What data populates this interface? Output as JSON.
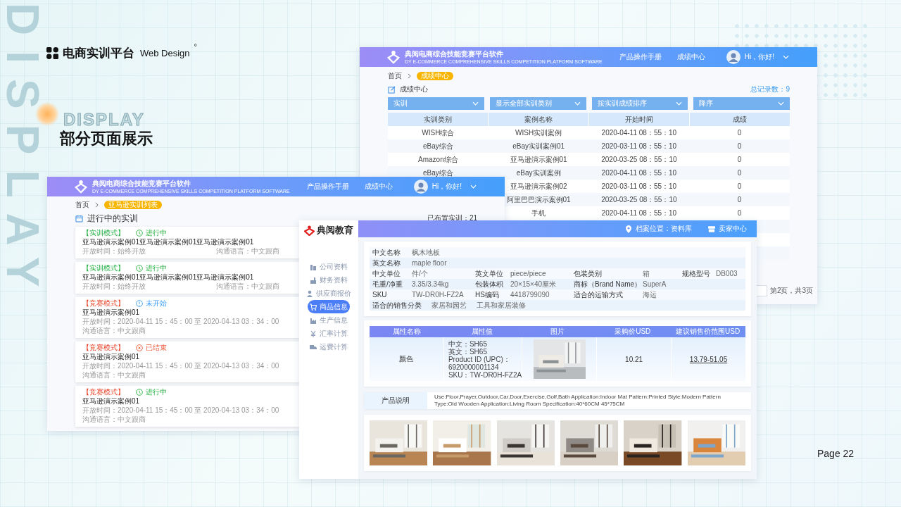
{
  "slide": {
    "watermark_vertical": "DISPLAY",
    "brand": "电商实训平台",
    "brand_sub": "Web Design",
    "brand_mark": "°",
    "watermark": "DISPLAY",
    "heading": "部分页面展示",
    "page": "Page 22"
  },
  "grades_window": {
    "title": "典阅电商综合技能竞赛平台软件",
    "subtitle": "DY E-COMMERCE COMPREHENSIVE SKILLS COMPETITION PLATFORM SOFTWARE",
    "nav": [
      "产品操作手册",
      "成绩中心"
    ],
    "greeting": "Hi，你好!",
    "breadcrumb": [
      "首页",
      "成绩中心"
    ],
    "heading": "成绩中心",
    "total": "总记录数：9",
    "filters": [
      "实训",
      "显示全部实训类别",
      "按实训成绩排序",
      "降序"
    ],
    "columns": [
      "实训类别",
      "案例名称",
      "开始时间",
      "成绩"
    ],
    "rows": [
      [
        "WISH综合",
        "WISH实训案例",
        "2020-04-11 08：55：10",
        "0"
      ],
      [
        "eBay综合",
        "eBay实训案例01",
        "2020-03-11 08：55：10",
        "0"
      ],
      [
        "Amazon综合",
        "亚马逊演示案例01",
        "2020-03-25 08：55：10",
        "0"
      ],
      [
        "eBay综合",
        "eBay实训案例",
        "2020-04-11 08：55：10",
        "0"
      ],
      [
        null,
        "亚马逊演示案例02",
        "2020-03-11 08：55：10",
        "0"
      ],
      [
        null,
        "阿里巴巴演示案例01",
        "2020-03-25 08：55：10",
        "0"
      ],
      [
        null,
        "手机",
        "2020-04-11 08：55：10",
        "0"
      ]
    ],
    "pagination": "第2页，共3页"
  },
  "training_window": {
    "title": "典阅电商综合技能竞赛平台软件",
    "subtitle": "DY E-COMMERCE COMPREHENSIVE SKILLS COMPETITION PLATFORM SOFTWARE",
    "nav": [
      "产品操作手册",
      "成绩中心"
    ],
    "greeting": "Hi，你好!",
    "breadcrumb": [
      "首页",
      "亚马逊实训列表"
    ],
    "heading": "进行中的实训",
    "count": "已布置实训：21",
    "cards": [
      {
        "kind": "training",
        "mode": "【实训模式】",
        "status": {
          "kind": "ongoing",
          "label": "进行中"
        },
        "title": "亚马逊演示案例01亚马逊演示案例01亚马逊演示案例01",
        "open_time": "开放时间：始终开放",
        "language": "沟通语言：中文跟商"
      },
      {
        "kind": "training",
        "mode": "【实训模式】",
        "status": {
          "kind": "ongoing",
          "label": "进行中"
        },
        "title": "亚马逊演示案例01亚马逊演示案例01亚马逊演示案例01",
        "open_time": "开放时间：始终开放",
        "language": "沟通语言：中文跟商"
      },
      {
        "kind": "contest",
        "mode": "【竞赛模式】",
        "status": {
          "kind": "pending",
          "label": "未开始"
        },
        "title": "亚马逊演示案例01",
        "open_time": "开放时间：2020-04-11 15：45：00 至 2020-04-13 03：34：00",
        "language": "沟通语言：中文跟商"
      },
      {
        "kind": "contest",
        "mode": "【竞赛模式】",
        "status": {
          "kind": "ended",
          "label": "已结束"
        },
        "title": "亚马逊演示案例01",
        "open_time": "开放时间：2020-04-11 15：45：00 至 2020-04-13 03：34：00",
        "language": "沟通语言：中文跟商"
      },
      {
        "kind": "contest",
        "mode": "【竞赛模式】",
        "status": {
          "kind": "ongoing",
          "label": "进行中"
        },
        "title": "亚马逊演示案例01",
        "open_time": "开放时间：2020-04-11 15：45：00 至 2020-04-13 03：34：00",
        "language": "沟通语言：中文跟商"
      }
    ]
  },
  "product_window": {
    "brand": "典阅教育",
    "menu": [
      {
        "label": "公司资料",
        "selected": false
      },
      {
        "label": "财务资料",
        "selected": false
      },
      {
        "label": "供应商报价",
        "selected": false
      },
      {
        "label": "商品信息",
        "selected": true
      },
      {
        "label": "生产信息",
        "selected": false
      },
      {
        "label": "汇率计算",
        "selected": false
      },
      {
        "label": "运费计算",
        "selected": false
      }
    ],
    "location": "档案位置：资料库",
    "seller": "卖家中心",
    "info_rows": [
      {
        "kind": "pairs",
        "cells": [
          {
            "label": "中文名称",
            "value": "枫木地板"
          }
        ]
      },
      {
        "kind": "pairs",
        "cells": [
          {
            "label": "英文名称",
            "value": "maple floor"
          }
        ]
      },
      {
        "kind": "pairs",
        "cells": [
          {
            "label": "中文单位",
            "value": "件/个"
          },
          {
            "label": "英文单位",
            "value": "piece/piece"
          },
          {
            "label": "包装类别",
            "value": "箱"
          },
          {
            "label": "规格型号",
            "value": "DB003"
          }
        ]
      },
      {
        "kind": "pairs",
        "cells": [
          {
            "label": "毛重/净重",
            "value": "3.35/3.34kg"
          },
          {
            "label": "包装体积",
            "value": "20×15×40厘米"
          },
          {
            "label": "商标（Brand Name）",
            "value": "SuperA"
          }
        ]
      },
      {
        "kind": "pairs",
        "cells": [
          {
            "label": "SKU",
            "value": "TW-DR0H-FZ2A"
          },
          {
            "label": "HS编码",
            "value": "4418799090"
          },
          {
            "label": "适合的运输方式",
            "value": "海运"
          }
        ]
      },
      {
        "kind": "categories",
        "label": "适合的销售分类",
        "values": [
          "家居和园艺",
          "工具和家居装修"
        ]
      }
    ],
    "attr_columns": [
      "属性名称",
      "属性值",
      "图片",
      "采购价USD",
      "建议销售价范围USD"
    ],
    "attr_row": {
      "name": "颜色",
      "values": [
        "中文：SH65",
        "英文：SH65",
        "Product ID (UPC)：",
        "6920000001134",
        "SKU：TW-DR0H-FZ2A"
      ],
      "image": {
        "kind": "picture"
      },
      "price": "10.21",
      "suggested": "13.79-51.05"
    },
    "description_label": "产品说明",
    "description": "Use:Floor,Prayer,Outdoor,Car,Door,Exercise,Golf,Bath Application:Indoor Mat Pattern:Printed Style:Modern Pattern Type:Old Wooden Application:Living Room Specification:40*60CM 45*75CM",
    "gallery": [
      {
        "kind": "picture"
      },
      {
        "kind": "picture"
      },
      {
        "kind": "picture"
      },
      {
        "kind": "picture"
      },
      {
        "kind": "picture"
      },
      {
        "kind": "picture"
      }
    ]
  }
}
